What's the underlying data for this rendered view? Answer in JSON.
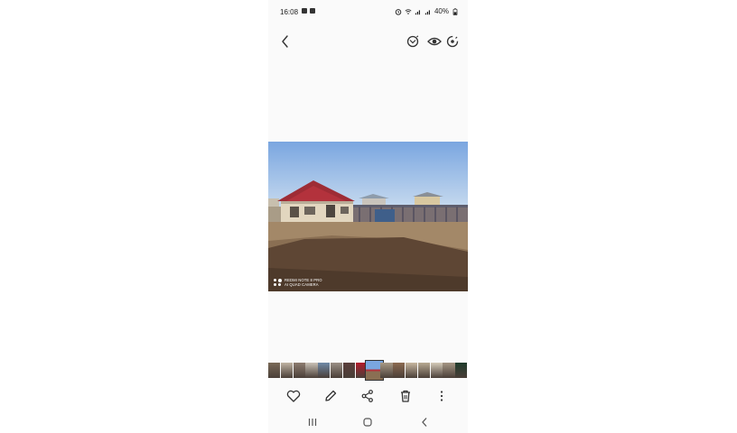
{
  "status_bar": {
    "time": "16:08",
    "battery": "40%",
    "icons": [
      "gallery-notification-icon",
      "photo-notification-icon",
      "alarm-icon",
      "wifi-icon",
      "signal-icon",
      "signal-icon-2",
      "battery-icon"
    ]
  },
  "toolbar": {
    "back_icon": "back-arrow-icon",
    "icons": [
      "remaster-icon",
      "view-icon",
      "bixby-vision-icon"
    ]
  },
  "photo": {
    "subject": "house with red roof and fenced dirt yard",
    "watermark_line1": "REDMI NOTE 8 PRO",
    "watermark_line2": "AI QUAD CAMERA"
  },
  "filmstrip": {
    "thumbnails": [
      {
        "color": "#7a6a58"
      },
      {
        "color": "#bfb3a3"
      },
      {
        "color": "#8d7c70"
      },
      {
        "color": "#c9c1b6"
      },
      {
        "color": "#6f8aa8"
      },
      {
        "color": "#9a8f85"
      },
      {
        "color": "#5a3e3a"
      },
      {
        "color": "#b31a2a"
      },
      {
        "color": "#7da0d0",
        "selected": true
      },
      {
        "color": "#a89a86"
      },
      {
        "color": "#8c6a50"
      },
      {
        "color": "#c7b79f"
      },
      {
        "color": "#b8aa92"
      },
      {
        "color": "#d5cbb9"
      },
      {
        "color": "#a59684"
      },
      {
        "color": "#1f3b2c"
      }
    ]
  },
  "actions": [
    "favorite-icon",
    "edit-icon",
    "share-icon",
    "delete-icon",
    "more-options-icon"
  ],
  "nav_bar": [
    "recent-apps-icon",
    "home-icon",
    "back-icon"
  ]
}
